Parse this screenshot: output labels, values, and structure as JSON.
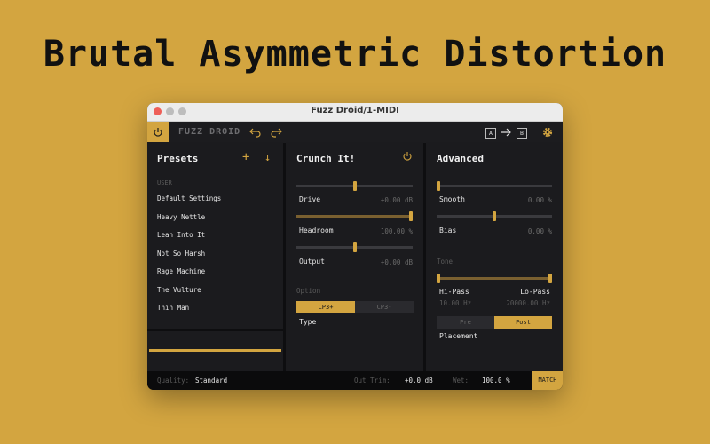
{
  "headline": "Brutal Asymmetric Distortion",
  "window": {
    "title": "Fuzz Droid/1-MIDI"
  },
  "toolbar": {
    "product": "FUZZ DROID",
    "ab_a": "A",
    "ab_b": "B"
  },
  "presets": {
    "title": "Presets",
    "section": "USER",
    "items": [
      "Default Settings",
      "Heavy Nettle",
      "Lean Into It",
      "Not So Harsh",
      "Rage Machine",
      "The Vulture",
      "Thin Man"
    ]
  },
  "crunch": {
    "title": "Crunch It!",
    "drive": {
      "label": "Drive",
      "value": "+0.00 dB",
      "level": 0.5
    },
    "headroom": {
      "label": "Headroom",
      "value": "100.00 %",
      "level": 1.0
    },
    "output": {
      "label": "Output",
      "value": "+0.00 dB",
      "level": 0.5
    },
    "option_label": "Option",
    "type_options": [
      "CP3+",
      "CP3-"
    ],
    "type_selected": "CP3+",
    "type_label": "Type"
  },
  "advanced": {
    "title": "Advanced",
    "smooth": {
      "label": "Smooth",
      "value": "0.00 %",
      "level": 0.0
    },
    "bias": {
      "label": "Bias",
      "value": "0.00 %",
      "level": 0.5
    },
    "tone_label": "Tone",
    "hipass": {
      "label": "Hi-Pass",
      "value": "10.00 Hz"
    },
    "lopass": {
      "label": "Lo-Pass",
      "value": "20000.00 Hz"
    },
    "placement_options": [
      "Pre",
      "Post"
    ],
    "placement_selected": "Post",
    "placement_label": "Placement"
  },
  "bottom": {
    "quality_label": "Quality:",
    "quality_value": "Standard",
    "outtrim_label": "Out Trim:",
    "outtrim_value": "+0.0 dB",
    "wet_label": "Wet:",
    "wet_value": "100.0 %",
    "match_label": "MATCH"
  },
  "colors": {
    "accent": "#D3A540",
    "panel": "#1b1b1e",
    "window": "#0e0e10"
  }
}
